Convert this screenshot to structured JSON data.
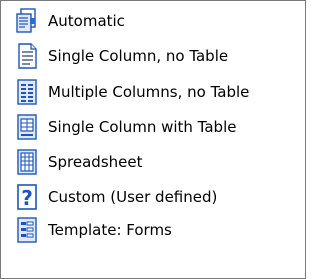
{
  "menu": {
    "items": [
      {
        "label": "Automatic",
        "icon": "auto-layout-icon"
      },
      {
        "label": "Single Column, no Table",
        "icon": "single-column-doc-icon"
      },
      {
        "label": "Multiple Columns, no Table",
        "icon": "multiple-columns-doc-icon"
      },
      {
        "label": "Single Column with Table",
        "icon": "single-column-table-icon"
      },
      {
        "label": "Spreadsheet",
        "icon": "spreadsheet-icon"
      },
      {
        "label": "Custom (User defined)",
        "icon": "question-mark-icon"
      },
      {
        "label": "Template: Forms",
        "icon": "template-forms-icon"
      }
    ]
  },
  "colors": {
    "border": "#7a7a7a",
    "icon_blue": "#2a6bd6",
    "icon_light": "#dfe9fb"
  }
}
